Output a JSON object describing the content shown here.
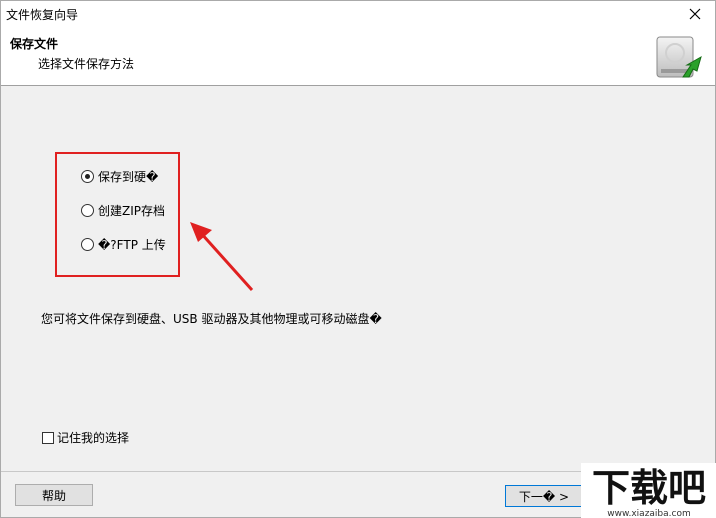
{
  "window": {
    "title": "文件恢复向导",
    "close_glyph": "✕"
  },
  "header": {
    "title": "保存文件",
    "subtitle": "选择文件保存方法",
    "icon": "drive-restore-icon"
  },
  "options": {
    "items": [
      {
        "label": "保存到硬�",
        "selected": true
      },
      {
        "label": "创建ZIP存档",
        "selected": false
      },
      {
        "label": "�?FTP 上传",
        "selected": false
      }
    ]
  },
  "description": "您可将文件保存到硬盘、USB 驱动器及其他物理或可移动磁盘�",
  "remember": {
    "label": "记住我的选择",
    "checked": false
  },
  "buttons": {
    "help": "帮助",
    "next": "下一� >"
  },
  "watermark": {
    "main": "下载吧",
    "url": "www.xiazaiba.com"
  },
  "colors": {
    "highlight": "#e02020",
    "arrow": "#e02020",
    "accent": "#0078d7"
  }
}
